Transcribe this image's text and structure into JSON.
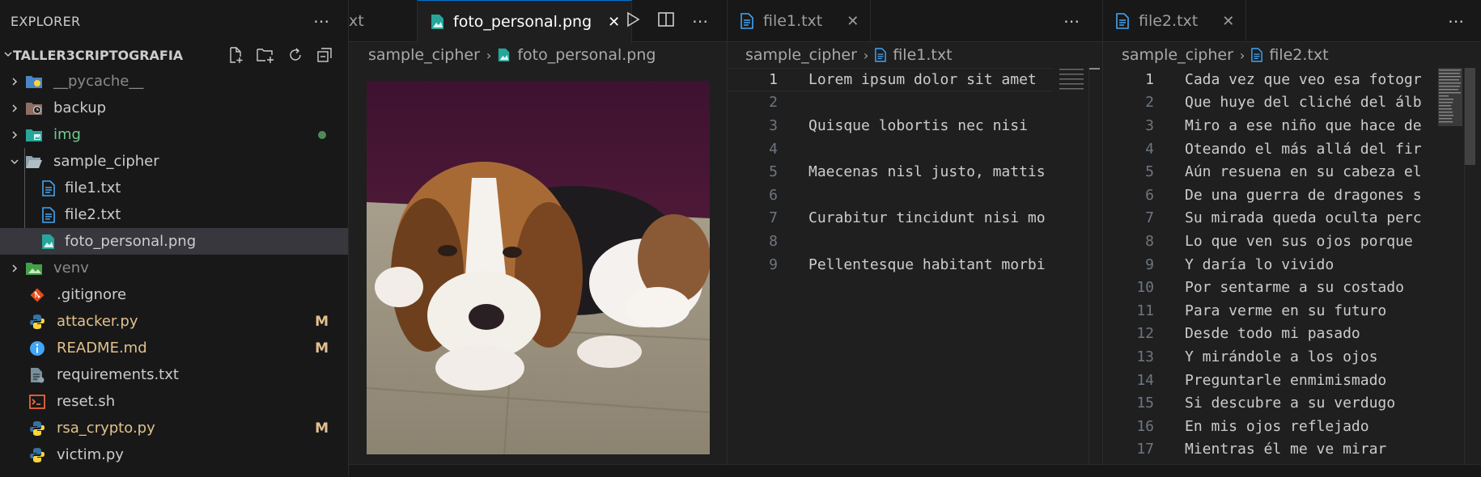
{
  "explorer": {
    "title": "EXPLORER",
    "workspace": "TALLER3CRIPTOGRAFIA",
    "items": [
      {
        "label": "__pycache__",
        "kind": "folder",
        "icon": "pycache-folder-icon"
      },
      {
        "label": "backup",
        "kind": "folder",
        "icon": "backup-folder-icon"
      },
      {
        "label": "img",
        "kind": "folder",
        "icon": "image-folder-icon",
        "status": "dot"
      },
      {
        "label": "sample_cipher",
        "kind": "folder-open",
        "icon": "folder-open-icon"
      },
      {
        "label": "file1.txt",
        "kind": "file",
        "icon": "text-file-icon"
      },
      {
        "label": "file2.txt",
        "kind": "file",
        "icon": "text-file-icon"
      },
      {
        "label": "foto_personal.png",
        "kind": "file",
        "icon": "image-file-icon",
        "selected": true
      },
      {
        "label": "venv",
        "kind": "folder",
        "icon": "venv-folder-icon"
      },
      {
        "label": ".gitignore",
        "kind": "file",
        "icon": "git-icon"
      },
      {
        "label": "attacker.py",
        "kind": "file",
        "icon": "python-icon",
        "badge": "M"
      },
      {
        "label": "README.md",
        "kind": "file",
        "icon": "info-icon",
        "badge": "M"
      },
      {
        "label": "requirements.txt",
        "kind": "file",
        "icon": "requirements-icon"
      },
      {
        "label": "reset.sh",
        "kind": "file",
        "icon": "shell-icon"
      },
      {
        "label": "rsa_crypto.py",
        "kind": "file",
        "icon": "python-icon",
        "badge": "M"
      },
      {
        "label": "victim.py",
        "kind": "file",
        "icon": "python-icon"
      }
    ]
  },
  "group1": {
    "prev_tab": "xt",
    "tab": "foto_personal.png",
    "breadcrumb": [
      "sample_cipher",
      "foto_personal.png"
    ]
  },
  "group2": {
    "tab": "file1.txt",
    "breadcrumb": [
      "sample_cipher",
      "file1.txt"
    ],
    "lines": [
      {
        "n": "1",
        "text": "Lorem ipsum dolor sit amet"
      },
      {
        "n": "2",
        "text": ""
      },
      {
        "n": "3",
        "text": "Quisque lobortis nec nisi "
      },
      {
        "n": "4",
        "text": ""
      },
      {
        "n": "5",
        "text": "Maecenas nisl justo, mattis"
      },
      {
        "n": "6",
        "text": ""
      },
      {
        "n": "7",
        "text": "Curabitur tincidunt nisi mo"
      },
      {
        "n": "8",
        "text": ""
      },
      {
        "n": "9",
        "text": "Pellentesque habitant morbi"
      }
    ]
  },
  "group3": {
    "tab": "file2.txt",
    "breadcrumb": [
      "sample_cipher",
      "file2.txt"
    ],
    "lines": [
      {
        "n": "1",
        "text": "Cada vez que veo esa fotogr"
      },
      {
        "n": "2",
        "text": "Que huye del cliché del álb"
      },
      {
        "n": "3",
        "text": "Miro a ese niño que hace de"
      },
      {
        "n": "4",
        "text": "Oteando el más allá del fir"
      },
      {
        "n": "5",
        "text": "Aún resuena en su cabeza el"
      },
      {
        "n": "6",
        "text": "De una guerra de dragones s"
      },
      {
        "n": "7",
        "text": "Su mirada queda oculta perc"
      },
      {
        "n": "8",
        "text": "Lo que ven sus ojos porque "
      },
      {
        "n": "9",
        "text": "Y daría lo vivido"
      },
      {
        "n": "10",
        "text": "Por sentarme a su costado"
      },
      {
        "n": "11",
        "text": "Para verme en su futuro"
      },
      {
        "n": "12",
        "text": "Desde todo mi pasado"
      },
      {
        "n": "13",
        "text": "Y mirándole a los ojos"
      },
      {
        "n": "14",
        "text": "Preguntarle enmimismado"
      },
      {
        "n": "15",
        "text": "Si descubre a su verdugo"
      },
      {
        "n": "16",
        "text": "En mis ojos reflejado"
      },
      {
        "n": "17",
        "text": "Mientras él me ve mirar"
      }
    ]
  },
  "colors": {
    "accent": "#0078d4",
    "modified": "#e2c08d",
    "untracked": "#73c991",
    "python_blue": "#3572a5",
    "python_yellow": "#ffd43b"
  }
}
